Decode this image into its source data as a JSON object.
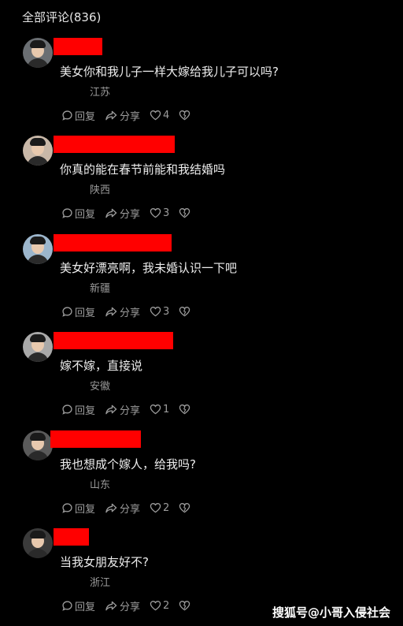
{
  "header": {
    "title": "全部评论(836)"
  },
  "comments": [
    {
      "text": "美女你和我儿子一样大嫁给我儿子可以吗?",
      "location": "江苏",
      "likes": "4",
      "avatar_tone": "#6b6f73"
    },
    {
      "text": "你真的能在春节前能和我结婚吗",
      "location": "陕西",
      "likes": "3",
      "avatar_tone": "#c9b8a8"
    },
    {
      "text": "美女好漂亮啊，我未婚认识一下吧",
      "location": "新疆",
      "likes": "3",
      "avatar_tone": "#9cb6cc"
    },
    {
      "text": "嫁不嫁，直接说",
      "location": "安徽",
      "likes": "1",
      "avatar_tone": "#a9a9a9"
    },
    {
      "text": "我也想成个嫁人，给我吗?",
      "location": "山东",
      "likes": "2",
      "avatar_tone": "#5a5a5a"
    },
    {
      "text": "当我女朋友好不?",
      "location": "浙江",
      "likes": "2",
      "avatar_tone": "#3a3a3a"
    }
  ],
  "actions": {
    "reply": "回复",
    "share": "分享"
  },
  "watermark": "搜狐号@小哥入侵社会",
  "colors": {
    "background": "#000000",
    "redaction": "#ff0000"
  }
}
